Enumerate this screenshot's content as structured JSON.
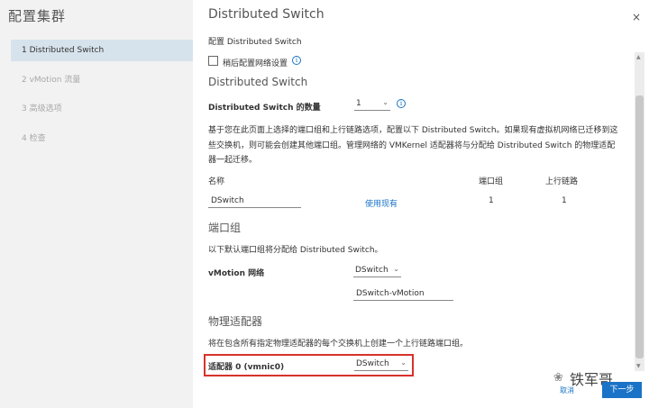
{
  "sidebar": {
    "title": "配置集群",
    "items": [
      {
        "label": "1 Distributed Switch",
        "active": true
      },
      {
        "label": "2 vMotion 流量",
        "active": false
      },
      {
        "label": "3 高级选项",
        "active": false
      },
      {
        "label": "4 检查",
        "active": false
      }
    ]
  },
  "main": {
    "title": "Distributed Switch",
    "close_icon": "×",
    "configure_label": "配置 Distributed Switch",
    "defer_checkbox_label": "稍后配置网络设置",
    "info_glyph": "i",
    "section_switch": "Distributed Switch",
    "switch_count_label": "Distributed Switch 的数量",
    "switch_count_value": "1",
    "description_line1": "基于您在此页面上选择的端口组和上行链路选项，配置以下 Distributed Switch。如果现有虚拟机网络已迁移到这",
    "description_line2": "些交换机，则可能会创建其他端口组。管理网络的 VMKernel 适配器将与分配给 Distributed Switch 的物理适配",
    "description_line3": "器一起迁移。",
    "table": {
      "col_name": "名称",
      "col_portgroups": "端口组",
      "col_uplinks": "上行链路",
      "row": {
        "name": "DSwitch",
        "use_existing": "使用现有",
        "portgroups": "1",
        "uplinks": "1"
      }
    },
    "section_portgroup": "端口组",
    "portgroup_desc": "以下默认端口组将分配给 Distributed Switch。",
    "vmotion_label": "vMotion 网络",
    "vmotion_switch": "DSwitch",
    "vmotion_portgroup": "DSwitch-vMotion",
    "section_adapters": "物理适配器",
    "adapters_desc": "将在包含所有指定物理适配器的每个交换机上创建一个上行链路端口组。",
    "adapter_label": "适配器 0 (vmnic0)",
    "adapter_switch": "DSwitch",
    "chevron": "⌄"
  },
  "footer": {
    "cancel": "取消",
    "next": "下一步"
  },
  "watermark": {
    "text": "铁军哥",
    "icon": "❀"
  },
  "scroll": {
    "up": "▲",
    "down": "▼"
  }
}
